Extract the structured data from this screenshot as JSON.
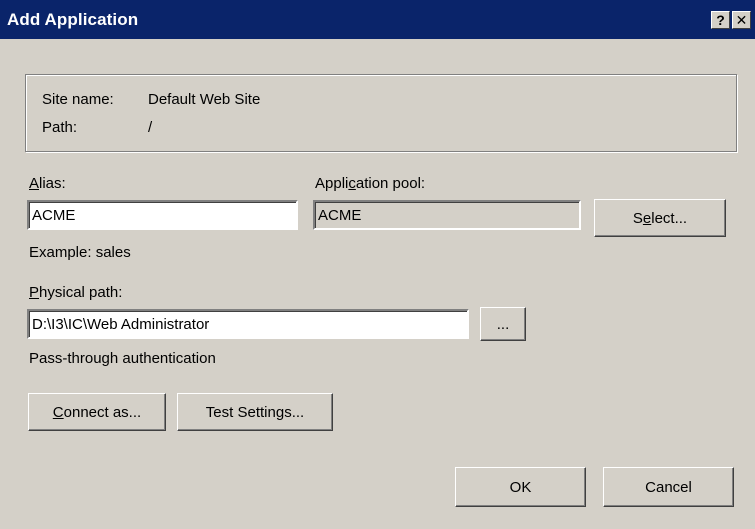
{
  "window": {
    "title": "Add Application",
    "help_glyph": "?",
    "close_glyph": "✕"
  },
  "site_info": {
    "site_name_label": "Site name:",
    "site_name_value": "Default Web Site",
    "path_label": "Path:",
    "path_value": "/"
  },
  "alias": {
    "label_mnemonic": "A",
    "label_rest": "lias:",
    "value": "ACME",
    "example": "Example: sales"
  },
  "app_pool": {
    "label_pre": "Appli",
    "label_mnemonic": "c",
    "label_post": "ation pool:",
    "value": "ACME",
    "select_pre": "S",
    "select_mnemonic": "e",
    "select_post": "lect..."
  },
  "physical_path": {
    "label_mnemonic": "P",
    "label_rest": "hysical path:",
    "value": "D:\\I3\\IC\\Web Administrator",
    "browse_label": "..."
  },
  "auth": {
    "text": "Pass-through authentication",
    "connect_mnemonic": "C",
    "connect_rest": "onnect as...",
    "test_pre": "Test Settin",
    "test_mnemonic": "g",
    "test_post": "s..."
  },
  "footer": {
    "ok_label": "OK",
    "cancel_label": "Cancel"
  }
}
